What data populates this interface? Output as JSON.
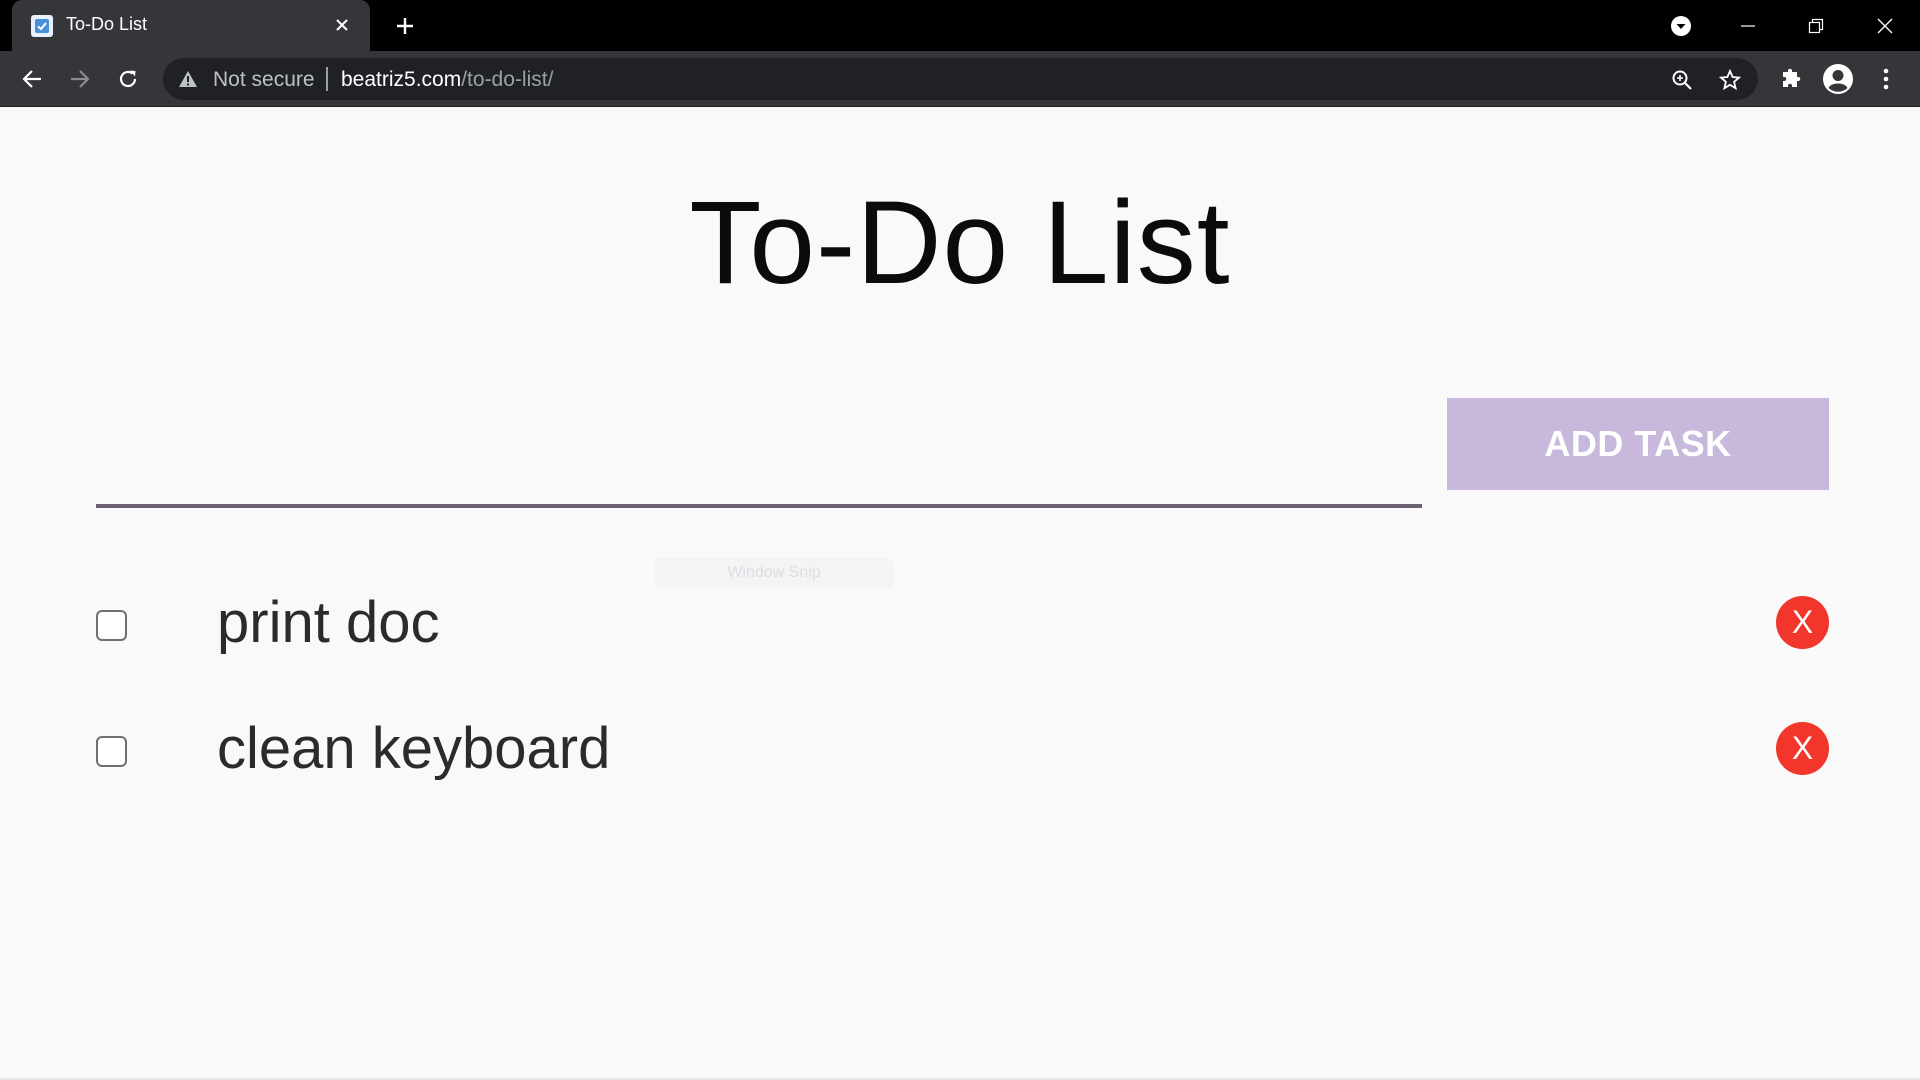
{
  "browser": {
    "tab": {
      "title": "To-Do List",
      "favicon": "checkbox-favicon-icon"
    },
    "new_tab_label": "+",
    "address_bar": {
      "security_label": "Not secure",
      "url_host": "beatriz5.com",
      "url_path": "/to-do-list/"
    }
  },
  "page": {
    "title": "To-Do List",
    "input": {
      "value": "",
      "placeholder": ""
    },
    "add_button_label": "ADD TASK",
    "watermark": "Window Snip",
    "tasks": [
      {
        "label": "print doc",
        "checked": false,
        "delete_label": "X"
      },
      {
        "label": "clean keyboard",
        "checked": false,
        "delete_label": "X"
      }
    ]
  },
  "colors": {
    "add_button_bg": "#c8b8dc",
    "delete_button_bg": "#f2362b",
    "input_underline": "#6b6375",
    "page_bg": "#f9f9f9"
  }
}
